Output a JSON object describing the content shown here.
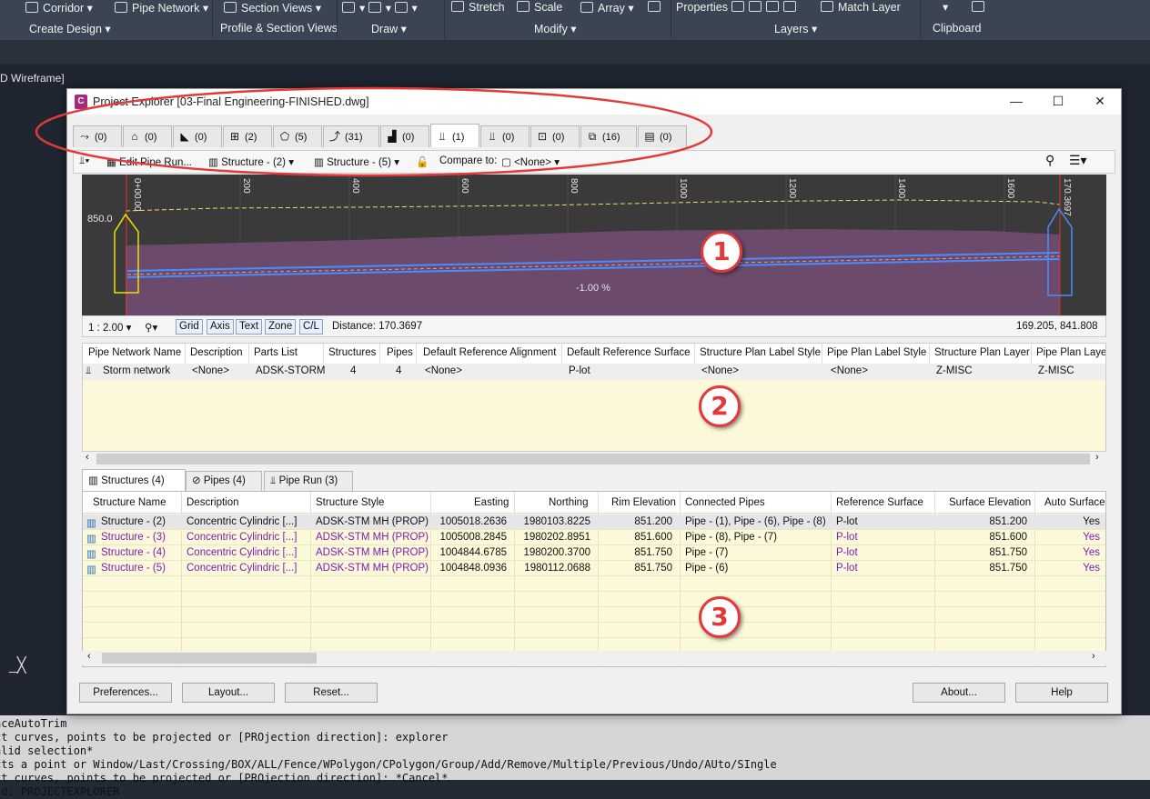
{
  "ribbon": {
    "tools": [
      "Corridor",
      "Pipe Network",
      "Section Views",
      "Stretch",
      "Scale",
      "Array",
      "Properties",
      "Match Layer"
    ],
    "panels": [
      "Create Design",
      "Profile & Section Views",
      "Draw",
      "Modify",
      "Layers",
      "Clipboard"
    ]
  },
  "viewport_label": "D Wireframe]",
  "close_glyph": "_╳",
  "command_lines": [
    "aceAutoTrim",
    "ct curves, points to be projected or [PROjection direction]: explorer",
    "alid selection*",
    "cts a point or Window/Last/Crossing/BOX/ALL/Fence/WPolygon/CPolygon/Group/Add/Remove/Multiple/Previous/Undo/AUto/SIngle",
    "ct curves, points to be projected or [PROjection direction]: *Cancel*",
    "nd: PROJECTEXPLORER"
  ],
  "dialog": {
    "title": "Project Explorer [03-Final Engineering-FINISHED.dwg]",
    "app_icon": "C",
    "window_buttons": [
      "—",
      "☐",
      "✕"
    ]
  },
  "object_tabs": [
    {
      "icon": "alignment-icon",
      "glyph": "⤳",
      "count": "(0)"
    },
    {
      "icon": "parcel-icon",
      "glyph": "⌂",
      "count": "(0)"
    },
    {
      "icon": "corridor-icon",
      "glyph": "◣",
      "count": "(0)"
    },
    {
      "icon": "profile-view-icon",
      "glyph": "⊞",
      "count": "(2)"
    },
    {
      "icon": "surface-icon",
      "glyph": "⬠",
      "count": "(5)"
    },
    {
      "icon": "feature-line-icon",
      "glyph": "⤴",
      "count": "(31)"
    },
    {
      "icon": "pipe-icon",
      "glyph": "▟",
      "count": "(0)"
    },
    {
      "icon": "pipe-network-icon",
      "glyph": "⫫",
      "count": "(1)"
    },
    {
      "icon": "pressure-network-icon",
      "glyph": "⫫",
      "count": "(0)"
    },
    {
      "icon": "section-icon",
      "glyph": "⊡",
      "count": "(0)"
    },
    {
      "icon": "view-frame-icon",
      "glyph": "⧉",
      "count": "(16)"
    },
    {
      "icon": "sheet-icon",
      "glyph": "▤",
      "count": "(0)"
    }
  ],
  "toolbar": {
    "edit_pipe_run": "Edit Pipe Run...",
    "structure_a": "Structure - (2)",
    "structure_b": "Structure - (5)",
    "compare_to_label": "Compare to:",
    "compare_to_value": "<None>"
  },
  "profile": {
    "elevation_label": "850.0",
    "stations": [
      "0+00.00",
      "200",
      "400",
      "600",
      "800",
      "1000",
      "1200",
      "1400",
      "1600",
      "170.3697"
    ],
    "slope_label": "-1.00 %"
  },
  "profile_status": {
    "scale": "1 : 2.00",
    "toggles": [
      "Grid",
      "Axis",
      "Text",
      "Zone",
      "C/L"
    ],
    "distance": "Distance: 170.3697",
    "coords": "169.205, 841.808"
  },
  "network_grid": {
    "headers": [
      "Pipe Network Name",
      "Description",
      "Parts List",
      "Structures",
      "Pipes",
      "Default Reference Alignment",
      "Default Reference Surface",
      "Structure Plan Label Style",
      "Pipe Plan Label Style",
      "Structure Plan Layer",
      "Pipe Plan Layer"
    ],
    "row": [
      "Storm network",
      "<None>",
      "ADSK-STORM",
      "4",
      "4",
      "<None>",
      "P-lot",
      "<None>",
      "<None>",
      "Z-MISC",
      "Z-MISC"
    ]
  },
  "sub_tabs": [
    {
      "label": "Structures (4)",
      "icon": "structure-icon"
    },
    {
      "label": "Pipes (4)",
      "icon": "pipe-icon"
    },
    {
      "label": "Pipe Run (3)",
      "icon": "pipe-run-icon"
    }
  ],
  "structure_grid": {
    "headers": [
      "Structure Name",
      "Description",
      "Structure Style",
      "Easting",
      "Northing",
      "Rim Elevation",
      "Connected Pipes",
      "Reference Surface",
      "Surface Elevation",
      "Auto Surface"
    ],
    "rows": [
      [
        "Structure - (2)",
        "Concentric Cylindric [...]",
        "ADSK-STM MH (PROP)",
        "1005018.2636",
        "1980103.8225",
        "851.200",
        "Pipe - (1), Pipe - (6), Pipe - (8)",
        "P-lot",
        "851.200",
        "Yes"
      ],
      [
        "Structure - (3)",
        "Concentric Cylindric [...]",
        "ADSK-STM MH (PROP)",
        "1005008.2845",
        "1980202.8951",
        "851.600",
        "Pipe - (8), Pipe - (7)",
        "P-lot",
        "851.600",
        "Yes"
      ],
      [
        "Structure - (4)",
        "Concentric Cylindric [...]",
        "ADSK-STM MH (PROP)",
        "1004844.6785",
        "1980200.3700",
        "851.750",
        "Pipe - (7)",
        "P-lot",
        "851.750",
        "Yes"
      ],
      [
        "Structure - (5)",
        "Concentric Cylindric [...]",
        "ADSK-STM MH (PROP)",
        "1004848.0936",
        "1980112.0688",
        "851.750",
        "Pipe - (6)",
        "P-lot",
        "851.750",
        "Yes"
      ]
    ]
  },
  "buttons": {
    "preferences": "Preferences...",
    "layout": "Layout...",
    "reset": "Reset...",
    "about": "About...",
    "help": "Help"
  },
  "callouts": [
    "1",
    "2",
    "3"
  ],
  "colors": {
    "callout": "#e23a3a",
    "linked_row_text": "#7a1fb0",
    "profile_fill": "#6b4a6c",
    "pipe_line": "#4a8cff"
  }
}
